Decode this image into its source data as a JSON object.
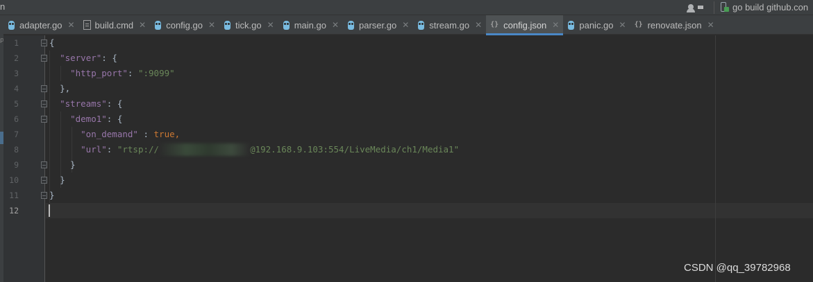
{
  "toolbar": {
    "left_clip": "n",
    "run_config": "go build github.con"
  },
  "tabs": [
    {
      "label": "adapter.go",
      "icon": "go-file-icon"
    },
    {
      "label": "build.cmd",
      "icon": "text-file-icon"
    },
    {
      "label": "config.go",
      "icon": "go-file-icon"
    },
    {
      "label": "tick.go",
      "icon": "go-file-icon"
    },
    {
      "label": "main.go",
      "icon": "go-file-icon"
    },
    {
      "label": "parser.go",
      "icon": "go-file-icon"
    },
    {
      "label": "stream.go",
      "icon": "go-file-icon"
    },
    {
      "label": "config.json",
      "icon": "json-file-icon",
      "active": true
    },
    {
      "label": "panic.go",
      "icon": "go-file-icon"
    },
    {
      "label": "renovate.json",
      "icon": "json-file-icon"
    }
  ],
  "editor": {
    "line_numbers": [
      "1",
      "2",
      "3",
      "4",
      "5",
      "6",
      "7",
      "8",
      "9",
      "10",
      "11",
      "12"
    ],
    "current_line": "12",
    "code": {
      "l1": "{",
      "l2_key": "\"server\"",
      "l2_rest": ": {",
      "l3_key": "\"http_port\"",
      "l3_colon": ": ",
      "l3_val": "\":9099\"",
      "l4": "},",
      "l5_key": "\"streams\"",
      "l5_rest": ": {",
      "l6_key": "\"demo1\"",
      "l6_rest": ": {",
      "l7_key": "\"on_demand\"",
      "l7_colon": " : ",
      "l7_val": "true",
      "l7_comma": ",",
      "l8_key": "\"url\"",
      "l8_colon": ": ",
      "l8_val_start": "\"rtsp://",
      "l8_val_end": "@192.168.9.103:554/LiveMedia/ch1/Media1\"",
      "l9": "}",
      "l10": "}",
      "l11": "}"
    }
  },
  "watermark": "CSDN @qq_39782968",
  "colors": {
    "background": "#2b2b2b",
    "key": "#9876aa",
    "string": "#6a8759",
    "keyword": "#cc7832",
    "tab_active_underline": "#4a88c7"
  }
}
